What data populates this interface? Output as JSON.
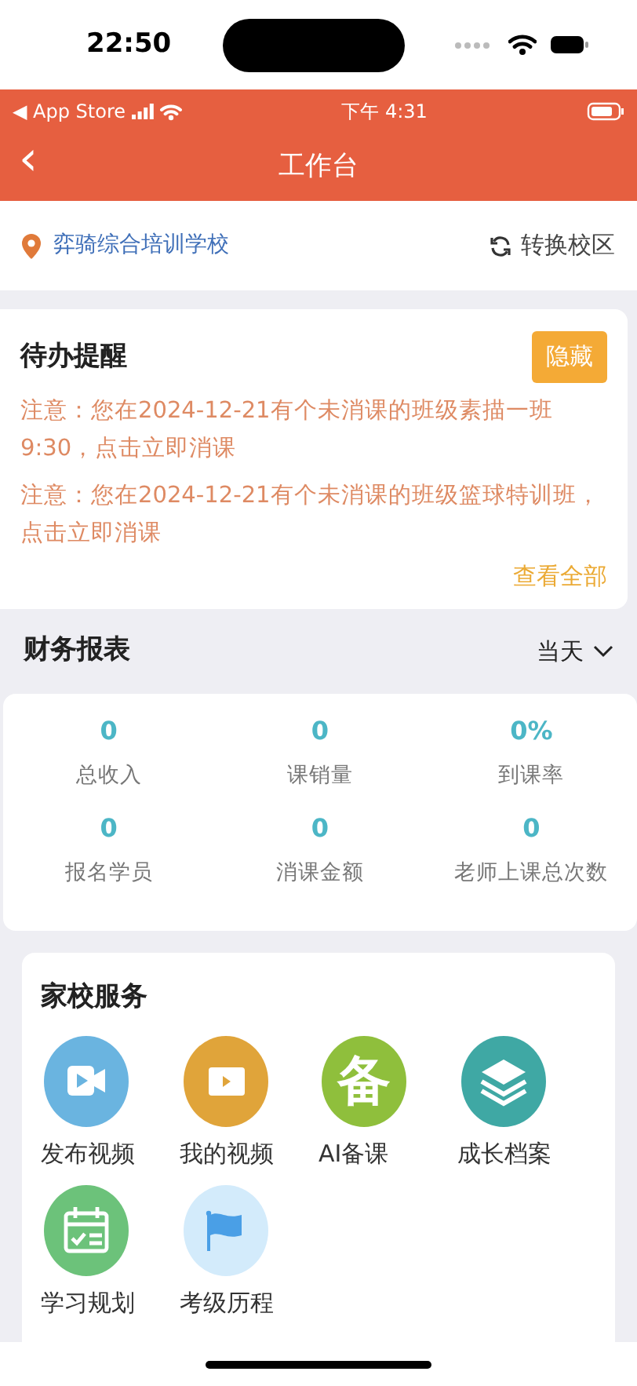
{
  "phone_status": {
    "time": "22:50"
  },
  "app_status": {
    "back_label": "◀ App Store",
    "time": "下午 4:31"
  },
  "navbar": {
    "back": "‹",
    "title": "工作台"
  },
  "school": {
    "name": "弈骑综合培训学校",
    "switch": "转换校区"
  },
  "todo": {
    "title": "待办提醒",
    "hide_button": "隐藏",
    "notices": [
      {
        "text": "注意：您在2024-12-21有个未消课的班级素描一班9:30，点击立即消课"
      },
      {
        "text": "注意：您在2024-12-21有个未消课的班级篮球特训班，点击立即消课"
      }
    ],
    "view_all": "查看全部"
  },
  "finance": {
    "title": "财务报表",
    "period": "当天",
    "stats": [
      {
        "value": "0",
        "label": "总收入"
      },
      {
        "value": "0",
        "label": "课销量"
      },
      {
        "value": "0%",
        "label": "到课率"
      },
      {
        "value": "0",
        "label": "报名学员"
      },
      {
        "value": "0",
        "label": "消课金额"
      },
      {
        "value": "0",
        "label": "老师上课总次数"
      }
    ]
  },
  "services": {
    "title": "家校服务",
    "items": [
      {
        "kind": "video-camera",
        "color": "#6ab4e0",
        "label": "发布视频"
      },
      {
        "kind": "play",
        "color": "#e0a43a",
        "label": "我的视频"
      },
      {
        "kind": "glyph",
        "color": "#8fbf3c",
        "glyph": "备",
        "label": "AI备课"
      },
      {
        "kind": "layers",
        "color": "#3fa8a4",
        "label": "成长档案"
      },
      {
        "kind": "calendar",
        "color": "#6cc27a",
        "label": "学习规划"
      },
      {
        "kind": "flag",
        "color": "#d3ebfb",
        "label": "考级历程"
      }
    ]
  }
}
